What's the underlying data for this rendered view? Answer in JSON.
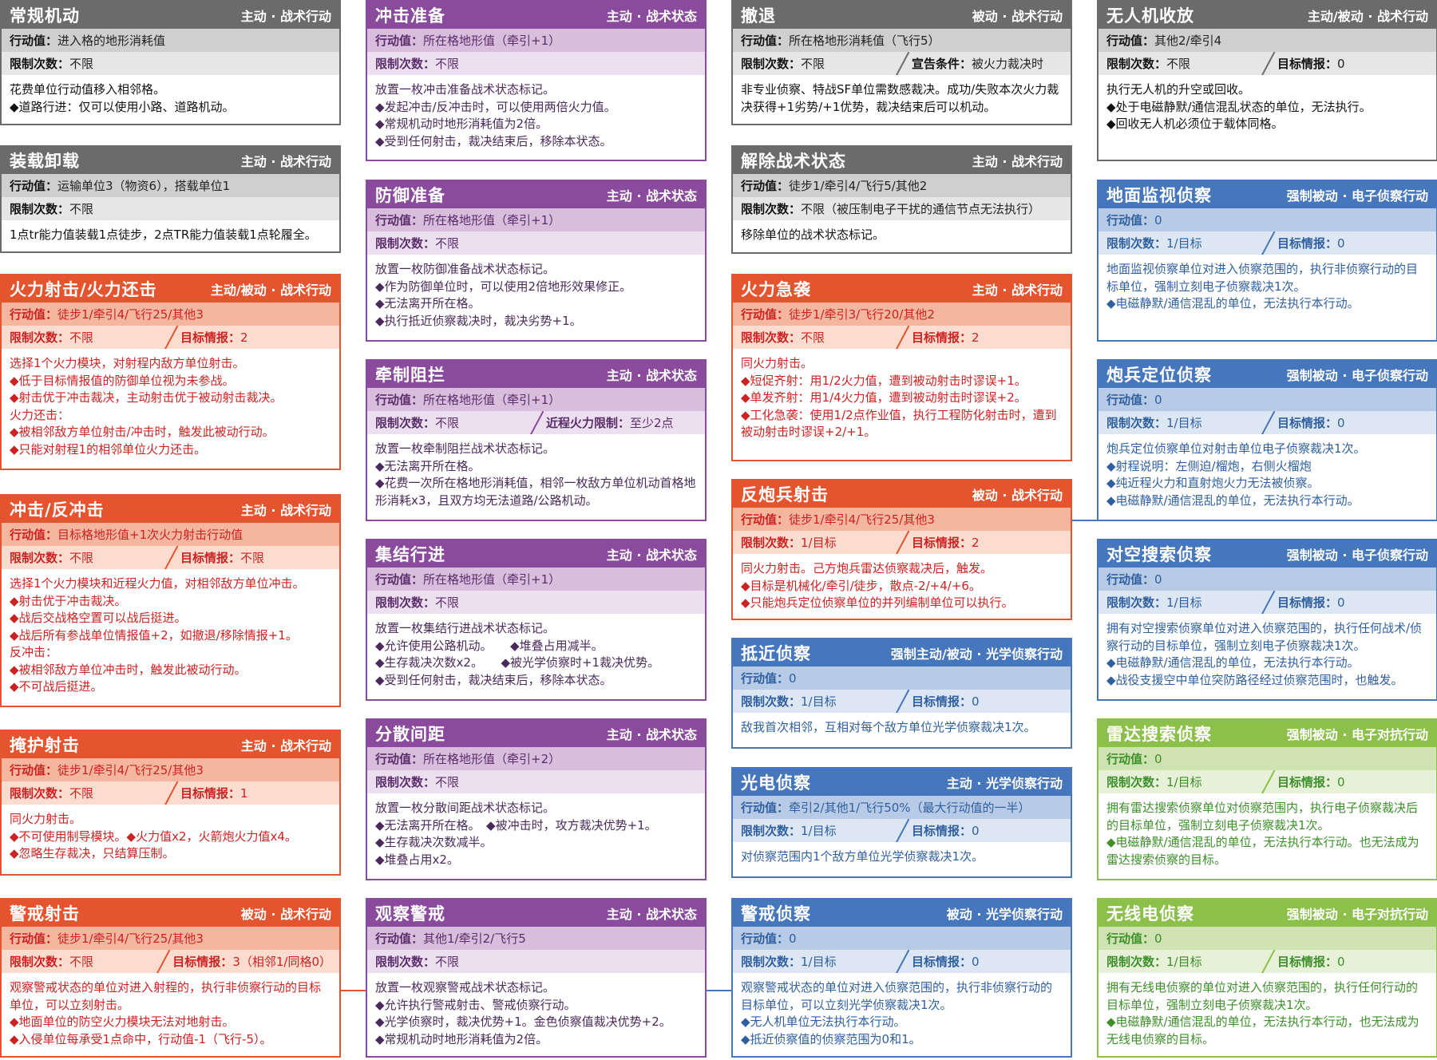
{
  "cards": [
    {
      "id": "c00",
      "name": "常规机动",
      "tag": "主动 · 战术行动",
      "av": "进入格的地形消耗值",
      "lim": "不限",
      "body": [
        "花费单位行动值移入相邻格。",
        "◆道路行进：仅可以使用小路、道路机动。"
      ]
    },
    {
      "id": "c01",
      "name": "装载卸载",
      "tag": "主动 · 战术行动",
      "av": "运输单位3（物资6），搭载单位1",
      "lim": "不限",
      "body": [
        "1点tr能力值装载1点徒步，2点TR能力值装载1点轮履全。"
      ]
    },
    {
      "id": "c02",
      "name": "火力射击/火力还击",
      "tag": "主动/被动 · 战术行动",
      "av": "徒步1/牵引4/飞行25/其他3",
      "lim": "不限",
      "intel": "2",
      "body": [
        "选择1个火力模块，对射程内敌方单位射击。",
        "◆低于目标情报值的防御单位视为未参战。",
        "◆射击优于冲击裁决，主动射击优于被动射击裁决。",
        "火力还击：",
        "◆被相邻敌方单位射击/冲击时，触发此被动行动。",
        "◆只能对射程1的相邻单位火力还击。"
      ]
    },
    {
      "id": "c03",
      "name": "冲击/反冲击",
      "tag": "主动 · 战术行动",
      "av": "目标格地形值+1次火力射击行动值",
      "lim": "不限",
      "intel": "不限",
      "body": [
        "选择1个火力模块和近程火力值，对相邻敌方单位冲击。",
        "◆射击优于冲击裁决。",
        "◆战后交战格空置可以战后挺进。",
        "◆战后所有参战单位情报值+2，如撤退/移除情报+1。",
        "反冲击：",
        "◆被相邻敌方单位冲击时，触发此被动行动。",
        "◆不可战后挺进。"
      ]
    },
    {
      "id": "c04",
      "name": "掩护射击",
      "tag": "主动 · 战术行动",
      "av": "徒步1/牵引4/飞行25/其他3",
      "lim": "不限",
      "intel": "1",
      "body": [
        "同火力射击。",
        "◆不可使用制导模块。◆火力值x2，火箭炮火力值x4。",
        "◆忽略生存裁决，只结算压制。"
      ]
    },
    {
      "id": "c05",
      "name": "警戒射击",
      "tag": "被动 · 战术行动",
      "av": "徒步1/牵引4/飞行25/其他3",
      "lim": "不限",
      "intel": "3（相邻1/同格0）",
      "body": [
        "观察警戒状态的单位对进入射程的，执行非侦察行动的目标单位，可以立刻射击。",
        "◆地面单位的防空火力模块无法对地射击。",
        "◆入侵单位每承受1点命中，行动值-1（飞行-5）。"
      ]
    },
    {
      "id": "c10",
      "name": "冲击准备",
      "tag": "主动 · 战术状态",
      "av": "所在格地形值（牵引+1）",
      "lim": "不限",
      "body": [
        "放置一枚冲击准备战术状态标记。",
        "◆发起冲击/反冲击时，可以使用两倍火力值。",
        "◆常规机动时地形消耗值为2倍。",
        "◆受到任何射击，裁决结束后，移除本状态。"
      ]
    },
    {
      "id": "c11",
      "name": "防御准备",
      "tag": "主动 · 战术状态",
      "av": "所在格地形值（牵引+1）",
      "lim": "不限",
      "body": [
        "放置一枚防御准备战术状态标记。",
        "◆作为防御单位时，可以使用2倍地形效果修正。",
        "◆无法离开所在格。",
        "◆执行抵近侦察裁决时，裁决劣势+1。"
      ]
    },
    {
      "id": "c12",
      "name": "牵制阻拦",
      "tag": "主动 · 战术状态",
      "av": "所在格地形值（牵引+1）",
      "lim": "不限",
      "extraK": "近程火力限制",
      "extraV": "至少2点",
      "body": [
        "放置一枚牵制阻拦战术状态标记。",
        "◆无法离开所在格。",
        "◆花费一次所在格地形消耗值，相邻一枚敌方单位机动首格地形消耗x3，且双方均无法道路/公路机动。"
      ]
    },
    {
      "id": "c13",
      "name": "集结行进",
      "tag": "主动 · 战术状态",
      "av": "所在格地形值（牵引+1）",
      "lim": "不限",
      "body": [
        "放置一枚集结行进战术状态标记。",
        "◆允许使用公路机动。　　◆堆叠占用减半。",
        "◆生存裁决次数x2。　　◆被光学侦察时+1裁决优势。",
        "◆受到任何射击，裁决结束后，移除本状态。"
      ]
    },
    {
      "id": "c14",
      "name": "分散间距",
      "tag": "主动 · 战术状态",
      "av": "所在格地形值（牵引+2）",
      "lim": "不限",
      "body": [
        "放置一枚分散间距战术状态标记。",
        "◆无法离开所在格。　◆被冲击时，攻方裁决优势+1。",
        "◆生存裁决次数减半。",
        "◆堆叠占用x2。"
      ]
    },
    {
      "id": "c15",
      "name": "观察警戒",
      "tag": "主动 · 战术状态",
      "av": "其他1/牵引2/飞行5",
      "lim": "不限",
      "body": [
        "放置一枚观察警戒战术状态标记。",
        "◆允许执行警戒射击、警戒侦察行动。",
        "◆光学侦察时，裁决优势+1。金色侦察值裁决优势+2。",
        "◆常规机动时地形消耗值为2倍。"
      ]
    },
    {
      "id": "c20",
      "name": "撤退",
      "tag": "被动 · 战术行动",
      "av": "所在格地形消耗值（飞行5）",
      "lim": "不限",
      "extraK": "宣告条件",
      "extraV": "被火力裁决时",
      "body": [
        "非专业侦察、特战SF单位需数感裁决。成功/失败本次火力裁决获得+1劣势/+1优势，裁决结束后可以机动。"
      ]
    },
    {
      "id": "c21",
      "name": "解除战术状态",
      "tag": "主动 · 战术行动",
      "av": "徒步1/牵引4/飞行5/其他2",
      "lim": "不限（被压制电子干扰的通信节点无法执行）",
      "body": [
        "移除单位的战术状态标记。"
      ]
    },
    {
      "id": "c22",
      "name": "火力急袭",
      "tag": "主动 · 战术行动",
      "av": "徒步1/牵引3/飞行20/其他2",
      "lim": "不限",
      "intel": "2",
      "body": [
        "同火力射击。",
        "◆短促齐射：用1/2火力值，遭到被动射击时谬误+1。",
        "◆单发齐射：用1/4火力值，遭到被动射击时谬误+2。",
        "◆工化急袭：使用1/2点作业值，执行工程防化射击时，遭到被动射击时谬误+2/+1。"
      ]
    },
    {
      "id": "c23",
      "name": "反炮兵射击",
      "tag": "被动 · 战术行动",
      "av": "徒步1/牵引4/飞行25/其他3",
      "lim": "1/目标",
      "intel": "2",
      "body": [
        "同火力射击。己方炮兵雷达侦察裁决后，触发。",
        "◆目标是机械化/牵引/徒步，散点-2/+4/+6。",
        "◆只能炮兵定位侦察单位的并列编制单位可以执行。"
      ]
    },
    {
      "id": "c24",
      "name": "抵近侦察",
      "tag": "强制主动/被动 · 光学侦察行动",
      "av": "0",
      "lim": "1/目标",
      "intel": "0",
      "body": [
        "敌我首次相邻，互相对每个敌方单位光学侦察裁决1次。"
      ]
    },
    {
      "id": "c25",
      "name": "光电侦察",
      "tag": "主动 · 光学侦察行动",
      "av": "牵引2/其他1/飞行50%（最大行动值的一半）",
      "lim": "1/目标",
      "intel": "0",
      "body": [
        "对侦察范围内1个敌方单位光学侦察裁决1次。"
      ]
    },
    {
      "id": "c26",
      "name": "警戒侦察",
      "tag": "被动 · 光学侦察行动",
      "av": "0",
      "lim": "1/目标",
      "intel": "0",
      "body": [
        "观察警戒状态的单位对进入侦察范围的，执行非侦察行动的目标单位，可以立刻光学侦察裁决1次。",
        "◆无人机单位无法执行本行动。",
        "◆抵近侦察值的侦察范围为0和1。"
      ]
    },
    {
      "id": "c30",
      "name": "无人机收放",
      "tag": "主动/被动 · 战术行动",
      "av": "其他2/牵引4",
      "lim": "不限",
      "intel": "0",
      "body": [
        "执行无人机的升空或回收。",
        "◆处于电磁静默/通信混乱状态的单位，无法执行。",
        "◆回收无人机必须位于载体同格。"
      ]
    },
    {
      "id": "c31",
      "name": "地面监视侦察",
      "tag": "强制被动 · 电子侦察行动",
      "av": "0",
      "lim": "1/目标",
      "intel": "0",
      "body": [
        "地面监视侦察单位对进入侦察范围的，执行非侦察行动的目标单位，强制立刻电子侦察裁决1次。",
        "◆电磁静默/通信混乱的单位，无法执行本行动。"
      ]
    },
    {
      "id": "c32",
      "name": "炮兵定位侦察",
      "tag": "强制被动 · 电子侦察行动",
      "av": "0",
      "lim": "1/目标",
      "intel": "0",
      "body": [
        "炮兵定位侦察单位对射击单位电子侦察裁决1次。",
        "◆射程说明：左侧迫/榴炮，右侧火榴炮",
        "◆纯近程火力和直射炮火力无法被侦察。",
        "◆电磁静默/通信混乱的单位，无法执行本行动。"
      ]
    },
    {
      "id": "c33",
      "name": "对空搜索侦察",
      "tag": "强制被动 · 电子侦察行动",
      "av": "0",
      "lim": "1/目标",
      "intel": "0",
      "body": [
        "拥有对空搜索侦察单位对进入侦察范围的，执行任何战术/侦察行动的目标单位，强制立刻电子侦察裁决1次。",
        "◆电磁静默/通信混乱的单位，无法执行本行动。",
        "◆战役支援空中单位突防路径经过侦察范围时，也触发。"
      ]
    },
    {
      "id": "c34",
      "name": "雷达搜索侦察",
      "tag": "强制被动 · 电子对抗行动",
      "av": "0",
      "lim": "1/目标",
      "intel": "0",
      "body": [
        "拥有雷达搜索侦察单位对侦察范围内，执行电子侦察裁决后的目标单位，强制立刻电子侦察裁决1次。",
        "◆电磁静默/通信混乱的单位，无法执行本行动。也无法成为雷达搜索侦察的目标。"
      ]
    },
    {
      "id": "c35",
      "name": "无线电侦察",
      "tag": "强制被动 · 电子对抗行动",
      "av": "0",
      "lim": "1/目标",
      "intel": "0",
      "body": [
        "拥有无线电侦察的单位对进入侦察范围的，执行任何行动的目标单位，强制立刻电子侦察裁决1次。",
        "◆电磁静默/通信混乱的单位，无法执行本行动，也无法成为无线电侦察的目标。"
      ]
    }
  ],
  "labels": {
    "action_value": "行动值",
    "limit": "限制次数",
    "intel": "目标情报",
    "colon": "："
  }
}
